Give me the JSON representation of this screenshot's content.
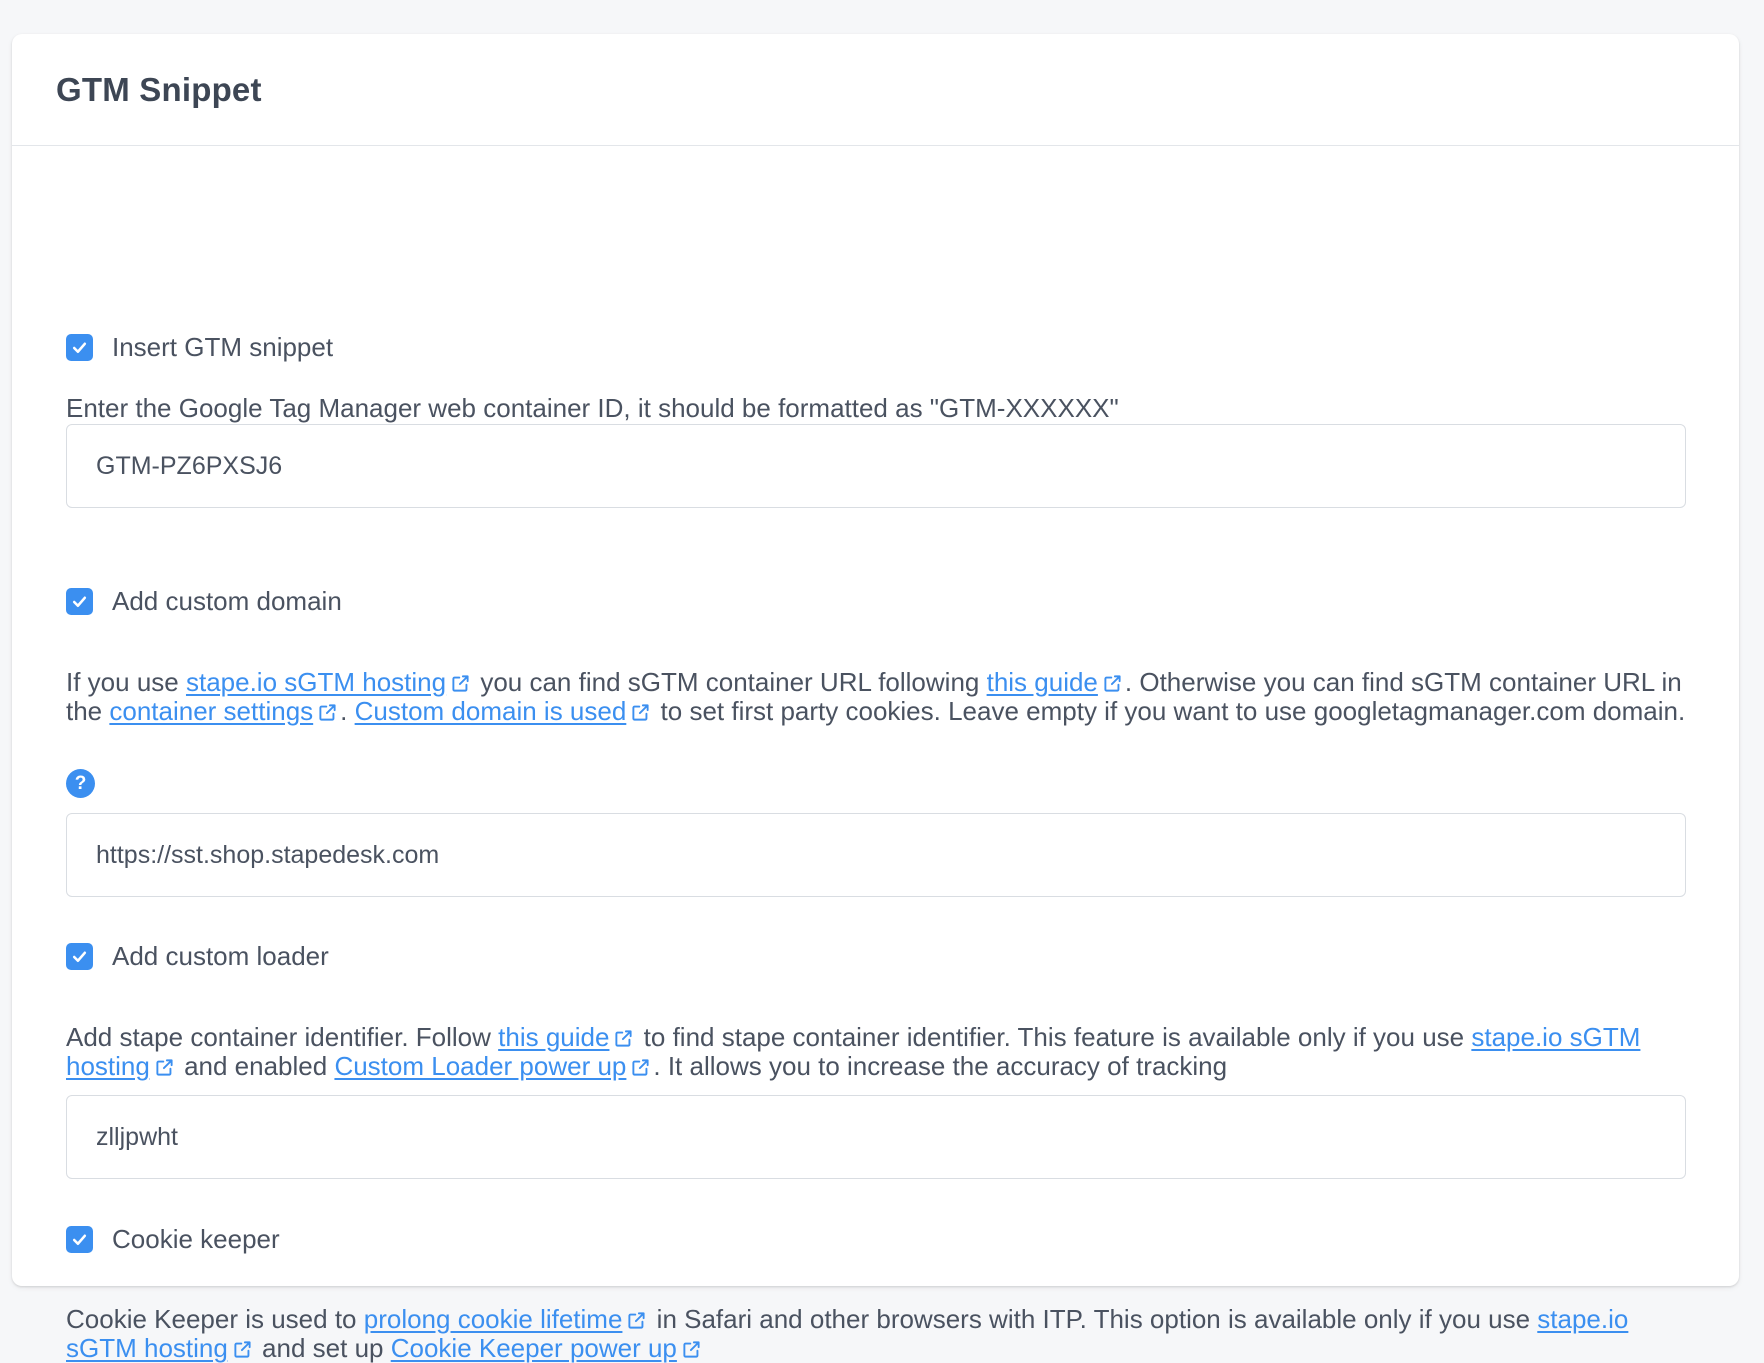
{
  "card": {
    "title": "GTM Snippet"
  },
  "insert_snippet": {
    "checked": true,
    "label": "Insert GTM snippet",
    "description": "Enter the Google Tag Manager web container ID, it should be formatted as \"GTM-XXXXXX\"",
    "input_value": "GTM-PZ6PXSJ6"
  },
  "custom_domain": {
    "checked": true,
    "label": "Add custom domain",
    "desc_part1": "If you use ",
    "link_hosting": "stape.io sGTM hosting",
    "desc_part2": " you can find sGTM container URL following ",
    "link_guide": "this guide",
    "desc_part3": ". Otherwise you can find sGTM container URL in the ",
    "link_settings": "container settings",
    "desc_part4": ". ",
    "link_used": "Custom domain is used",
    "desc_part5": " to set first party cookies. Leave empty if you want to use googletagmanager.com domain.",
    "help_glyph": "?",
    "input_value": "https://sst.shop.stapedesk.com"
  },
  "custom_loader": {
    "checked": true,
    "label": "Add custom loader",
    "desc_part1": "Add stape container identifier. Follow ",
    "link_guide": "this guide",
    "desc_part2": " to find stape container identifier. This feature is available only if you use ",
    "link_hosting": "stape.io sGTM hosting",
    "desc_part3": " and enabled ",
    "link_powerup": "Custom Loader power up",
    "desc_part4": ". It allows you to increase the accuracy of tracking",
    "input_value": "zlljpwht"
  },
  "cookie_keeper": {
    "checked": true,
    "label": "Cookie keeper",
    "desc_part1": "Cookie Keeper is used to ",
    "link_prolong": "prolong cookie lifetime",
    "desc_part2": " in Safari and other browsers with ITP. This option is available only if you use ",
    "link_hosting": "stape.io sGTM hosting",
    "desc_part3": " and set up ",
    "link_powerup": "Cookie Keeper power up"
  },
  "icons": {
    "checkbox": "check-icon",
    "external": "external-link-icon",
    "help": "question-circle-icon"
  },
  "colors": {
    "accent": "#3b8ff0",
    "text": "#4a5260",
    "border": "#d9dde2",
    "background": "#f6f7f9"
  }
}
